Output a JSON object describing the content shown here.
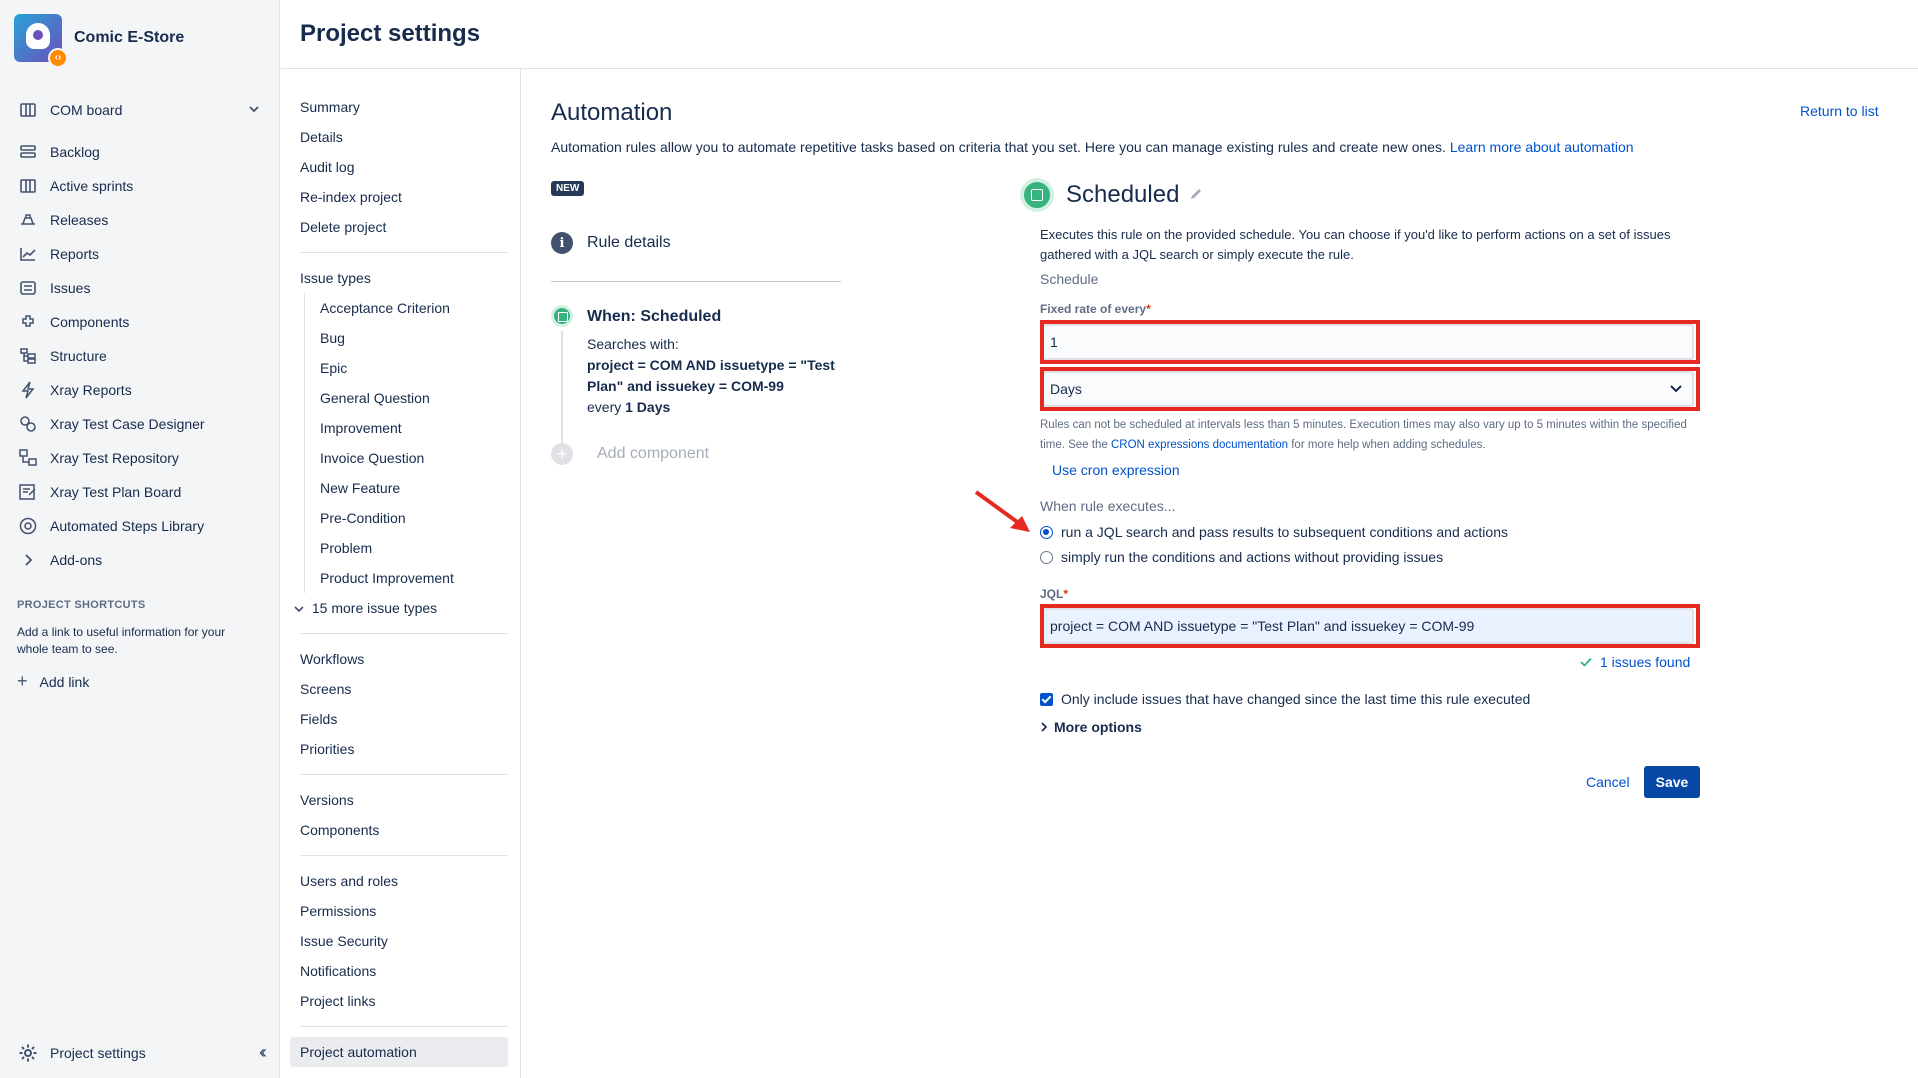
{
  "project": {
    "name": "Comic E-Store",
    "badge_glyph": "‹›"
  },
  "sidebar": {
    "items": [
      {
        "label": "COM board",
        "icon": "board-icon"
      },
      {
        "label": "Backlog",
        "icon": "backlog-icon"
      },
      {
        "label": "Active sprints",
        "icon": "sprints-icon"
      },
      {
        "label": "Releases",
        "icon": "releases-icon"
      },
      {
        "label": "Reports",
        "icon": "reports-icon"
      },
      {
        "label": "Issues",
        "icon": "issues-icon"
      },
      {
        "label": "Components",
        "icon": "components-icon"
      },
      {
        "label": "Structure",
        "icon": "structure-icon"
      },
      {
        "label": "Xray Reports",
        "icon": "xray-reports-icon"
      },
      {
        "label": "Xray Test Case Designer",
        "icon": "xray-designer-icon"
      },
      {
        "label": "Xray Test Repository",
        "icon": "xray-repository-icon"
      },
      {
        "label": "Xray Test Plan Board",
        "icon": "xray-plan-board-icon"
      },
      {
        "label": "Automated Steps Library",
        "icon": "steps-library-icon"
      },
      {
        "label": "Add-ons",
        "icon": "chevron-right-icon"
      }
    ],
    "shortcuts_title": "PROJECT SHORTCUTS",
    "shortcuts_desc": "Add a link to useful information for your whole team to see.",
    "add_link": "Add link",
    "footer_label": "Project settings"
  },
  "page": {
    "title": "Project settings"
  },
  "subnav": {
    "group1": [
      "Summary",
      "Details",
      "Audit log",
      "Re-index project",
      "Delete project"
    ],
    "issue_types_label": "Issue types",
    "issue_types": [
      "Acceptance Criterion",
      "Bug",
      "Epic",
      "General Question",
      "Improvement",
      "Invoice Question",
      "New Feature",
      "Pre-Condition",
      "Problem",
      "Product Improvement"
    ],
    "more_issue_types": "15 more issue types",
    "group3": [
      "Workflows",
      "Screens",
      "Fields",
      "Priorities"
    ],
    "group4": [
      "Versions",
      "Components"
    ],
    "group5": [
      "Users and roles",
      "Permissions",
      "Issue Security",
      "Notifications",
      "Project links"
    ],
    "active": "Project automation"
  },
  "automation": {
    "title": "Automation",
    "return_link": "Return to list",
    "desc": "Automation rules allow you to automate repetitive tasks based on criteria that you set. Here you can manage existing rules and create new ones.",
    "learn_more": "Learn more about automation",
    "new_badge": "NEW",
    "rule_details": "Rule details",
    "when_title": "When: Scheduled",
    "searches_with": "Searches with:",
    "jql_summary": "project = COM AND issuetype = \"Test Plan\" and issuekey = COM-99",
    "every_prefix": "every",
    "every_value": "1 Days",
    "add_component": "Add component"
  },
  "scheduled": {
    "title": "Scheduled",
    "desc": "Executes this rule on the provided schedule. You can choose if you'd like to perform actions on a set of issues gathered with a JQL search or simply execute the rule.",
    "schedule_label": "Schedule",
    "fixed_label": "Fixed rate of every",
    "fixed_value": "1",
    "unit_value": "Days",
    "cron_note_a": "Rules can not be scheduled at intervals less than 5 minutes. Execution times may also vary up to 5 minutes within the specified time. See the",
    "cron_link": "CRON expressions documentation",
    "cron_note_b": "for more help when adding schedules.",
    "use_cron": "Use cron expression",
    "when_exec": "When rule executes...",
    "radio1": "run a JQL search and pass results to subsequent conditions and actions",
    "radio2": "simply run the conditions and actions without providing issues",
    "jql_label": "JQL",
    "jql_value": "project = COM AND issuetype = \"Test Plan\" and issuekey = COM-99",
    "issues_found": "1 issues found",
    "only_include": "Only include issues that have changed since the last time this rule executed",
    "more_options": "More options",
    "cancel": "Cancel",
    "save": "Save"
  },
  "colors": {
    "accent": "#0052cc",
    "highlight": "#e52a21",
    "success": "#36b37e",
    "save_bg": "#0747a6"
  }
}
